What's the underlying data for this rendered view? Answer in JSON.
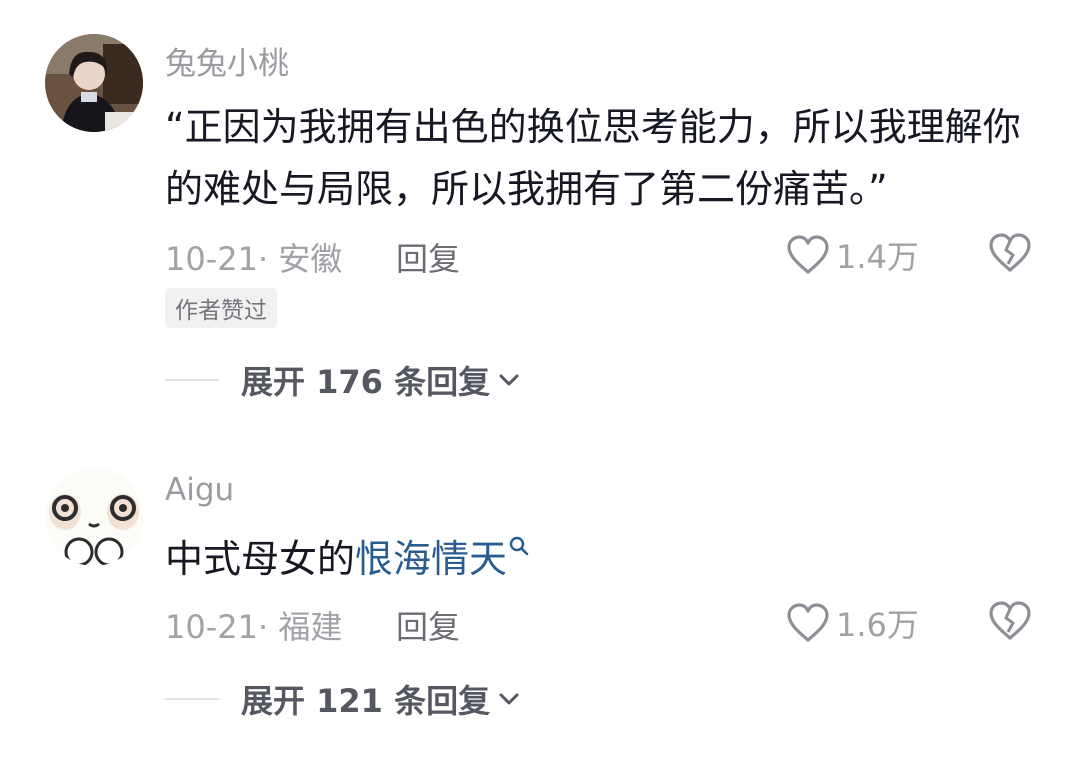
{
  "comments": [
    {
      "username": "兔兔小桃",
      "text": "“正因为我拥有出色的换位思考能力，所以我理解你的难处与局限，所以我拥有了第二份痛苦。”",
      "date": "10-21",
      "location": "· 安徽",
      "reply_label": "回复",
      "like_count": "1.4万",
      "badge": "作者赞过",
      "expand_label": "展开 176 条回复",
      "avatar_icon": "avatar-photo"
    },
    {
      "username": "Aigu",
      "text_prefix": "中式母女的",
      "text_link": "恨海情天",
      "date": "10-21",
      "location": "· 福建",
      "reply_label": "回复",
      "like_count": "1.6万",
      "expand_label": "展开 121 条回复",
      "avatar_icon": "cartoon-face-avatar"
    }
  ],
  "colors": {
    "link": "#2a5d8f",
    "secondary_text": "#a1a2a7",
    "primary_text": "#161823"
  },
  "icons": [
    "heart-icon",
    "broken-heart-icon",
    "search-icon",
    "chevron-down-icon"
  ]
}
